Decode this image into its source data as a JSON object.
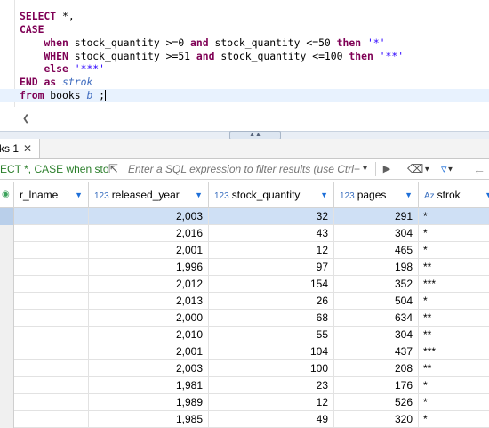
{
  "editor": {
    "sql_lines": [
      "SELECT *,",
      "CASE",
      "when stock_quantity >=0 and stock_quantity <=50 then '*'",
      "WHEN stock_quantity >=51 and stock_quantity <=100 then '**'",
      "else '***'",
      "END as strok",
      "from books b ;"
    ]
  },
  "results_tab": {
    "label": "ks 1",
    "close_icon": "close-icon"
  },
  "filter_bar": {
    "query_text": "ECT *, CASE when sto",
    "placeholder": "Enter a SQL expression to filter results (use Ctrl+",
    "icons": [
      "expand-icon",
      "history-dropdown-icon",
      "apply-filter-icon",
      "eraser-icon",
      "filter-icon",
      "back-arrow-icon"
    ]
  },
  "grid": {
    "columns": [
      {
        "name": "author_lname",
        "label": "r_lname",
        "type_icon": ""
      },
      {
        "name": "released_year",
        "label": "released_year",
        "type_icon": "123"
      },
      {
        "name": "stock_quantity",
        "label": "stock_quantity",
        "type_icon": "123"
      },
      {
        "name": "pages",
        "label": "pages",
        "type_icon": "123"
      },
      {
        "name": "strok",
        "label": "strok",
        "type_icon": "Az"
      }
    ],
    "rows": [
      {
        "author_lname": "",
        "released_year": "2,003",
        "stock_quantity": "32",
        "pages": "291",
        "strok": "*"
      },
      {
        "author_lname": "",
        "released_year": "2,016",
        "stock_quantity": "43",
        "pages": "304",
        "strok": "*"
      },
      {
        "author_lname": "",
        "released_year": "2,001",
        "stock_quantity": "12",
        "pages": "465",
        "strok": "*"
      },
      {
        "author_lname": "",
        "released_year": "1,996",
        "stock_quantity": "97",
        "pages": "198",
        "strok": "**"
      },
      {
        "author_lname": "",
        "released_year": "2,012",
        "stock_quantity": "154",
        "pages": "352",
        "strok": "***"
      },
      {
        "author_lname": "",
        "released_year": "2,013",
        "stock_quantity": "26",
        "pages": "504",
        "strok": "*"
      },
      {
        "author_lname": "",
        "released_year": "2,000",
        "stock_quantity": "68",
        "pages": "634",
        "strok": "**"
      },
      {
        "author_lname": "",
        "released_year": "2,010",
        "stock_quantity": "55",
        "pages": "304",
        "strok": "**"
      },
      {
        "author_lname": "",
        "released_year": "2,001",
        "stock_quantity": "104",
        "pages": "437",
        "strok": "***"
      },
      {
        "author_lname": "",
        "released_year": "2,003",
        "stock_quantity": "100",
        "pages": "208",
        "strok": "**"
      },
      {
        "author_lname": "",
        "released_year": "1,981",
        "stock_quantity": "23",
        "pages": "176",
        "strok": "*"
      },
      {
        "author_lname": "",
        "released_year": "1,989",
        "stock_quantity": "12",
        "pages": "526",
        "strok": "*"
      },
      {
        "author_lname": "",
        "released_year": "1,985",
        "stock_quantity": "49",
        "pages": "320",
        "strok": "*"
      }
    ]
  },
  "colors": {
    "keyword": "#7f0055",
    "string": "#2a00ff",
    "selection": "#cfe0f5",
    "accent": "#1e6fd8"
  }
}
